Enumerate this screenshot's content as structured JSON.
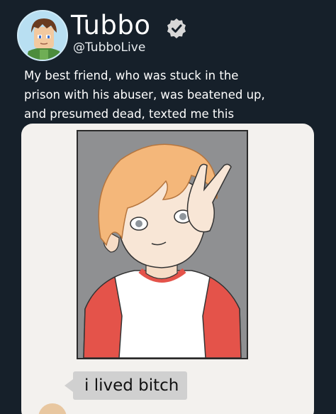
{
  "header": {
    "display_name": "Tubbo",
    "handle": "@TubboLive",
    "verified_icon": "verified-badge-icon"
  },
  "tweet": {
    "lines": [
      "My best friend, who was stuck in the",
      "prison with his abuser, was beatened up,",
      "and presumed dead, texted me this"
    ]
  },
  "media": {
    "message_text": "i lived bitch"
  },
  "colors": {
    "background": "#16202a",
    "card": "#f3f1ee",
    "bubble": "#d0d0d0",
    "hair": "#f4b77a",
    "shirt_sleeve": "#e4534a"
  }
}
